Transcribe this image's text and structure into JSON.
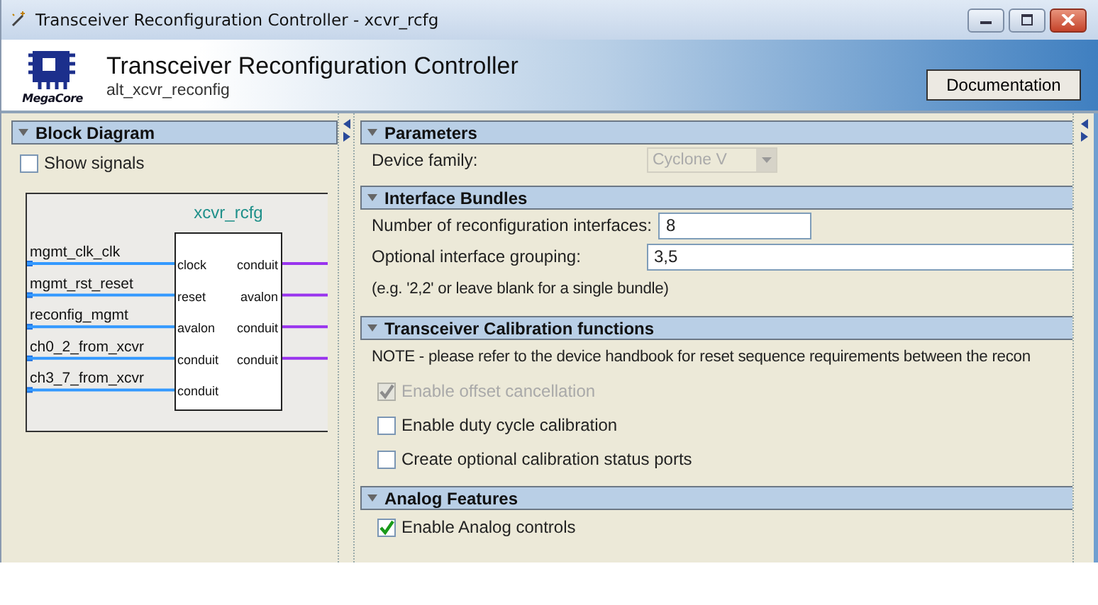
{
  "window": {
    "title": "Transceiver Reconfiguration Controller - xcvr_rcfg"
  },
  "header": {
    "logo_text": "MegaCore",
    "title": "Transceiver Reconfiguration Controller",
    "subtitle": "alt_xcvr_reconfig",
    "button": "Documentation"
  },
  "block_diagram": {
    "title": "Block Diagram",
    "expanded": true,
    "show_signals": {
      "label": "Show signals",
      "checked": false
    },
    "diagram": {
      "title": "xcvr_rcfg",
      "inputs": [
        {
          "signal": "mgmt_clk_clk",
          "port": "clock"
        },
        {
          "signal": "mgmt_rst_reset",
          "port": "reset"
        },
        {
          "signal": "reconfig_mgmt",
          "port": "avalon"
        },
        {
          "signal": "ch0_2_from_xcvr",
          "port": "conduit"
        },
        {
          "signal": "ch3_7_from_xcvr",
          "port": "conduit"
        }
      ],
      "outputs": [
        "conduit",
        "avalon",
        "conduit",
        "conduit"
      ]
    }
  },
  "sections": [
    {
      "title": "Parameters",
      "expanded": true,
      "rows": [
        {
          "kind": "select",
          "label": "Device family:",
          "value": "Cyclone V",
          "disabled": true
        }
      ]
    },
    {
      "title": "Interface Bundles",
      "expanded": true,
      "rows": [
        {
          "kind": "text",
          "label": "Number of reconfiguration interfaces:",
          "value": "8",
          "wide": false
        },
        {
          "kind": "text",
          "label": "Optional interface grouping:",
          "value": "3,5",
          "wide": true
        },
        {
          "kind": "note",
          "text": "(e.g. '2,2' or leave blank for a single bundle)"
        }
      ]
    },
    {
      "title": "Transceiver Calibration functions",
      "expanded": true,
      "rows": [
        {
          "kind": "note",
          "text": "NOTE - please refer to the device handbook for reset sequence requirements between the recon"
        },
        {
          "kind": "checkbox",
          "label": "Enable offset cancellation",
          "checked": true,
          "disabled": true
        },
        {
          "kind": "checkbox",
          "label": "Enable duty cycle calibration",
          "checked": false,
          "disabled": false
        },
        {
          "kind": "checkbox",
          "label": "Create optional calibration status ports",
          "checked": false,
          "disabled": false
        }
      ]
    },
    {
      "title": "Analog Features",
      "expanded": true,
      "rows": [
        {
          "kind": "checkbox",
          "label": "Enable Analog controls",
          "checked": true,
          "disabled": false
        }
      ]
    }
  ]
}
